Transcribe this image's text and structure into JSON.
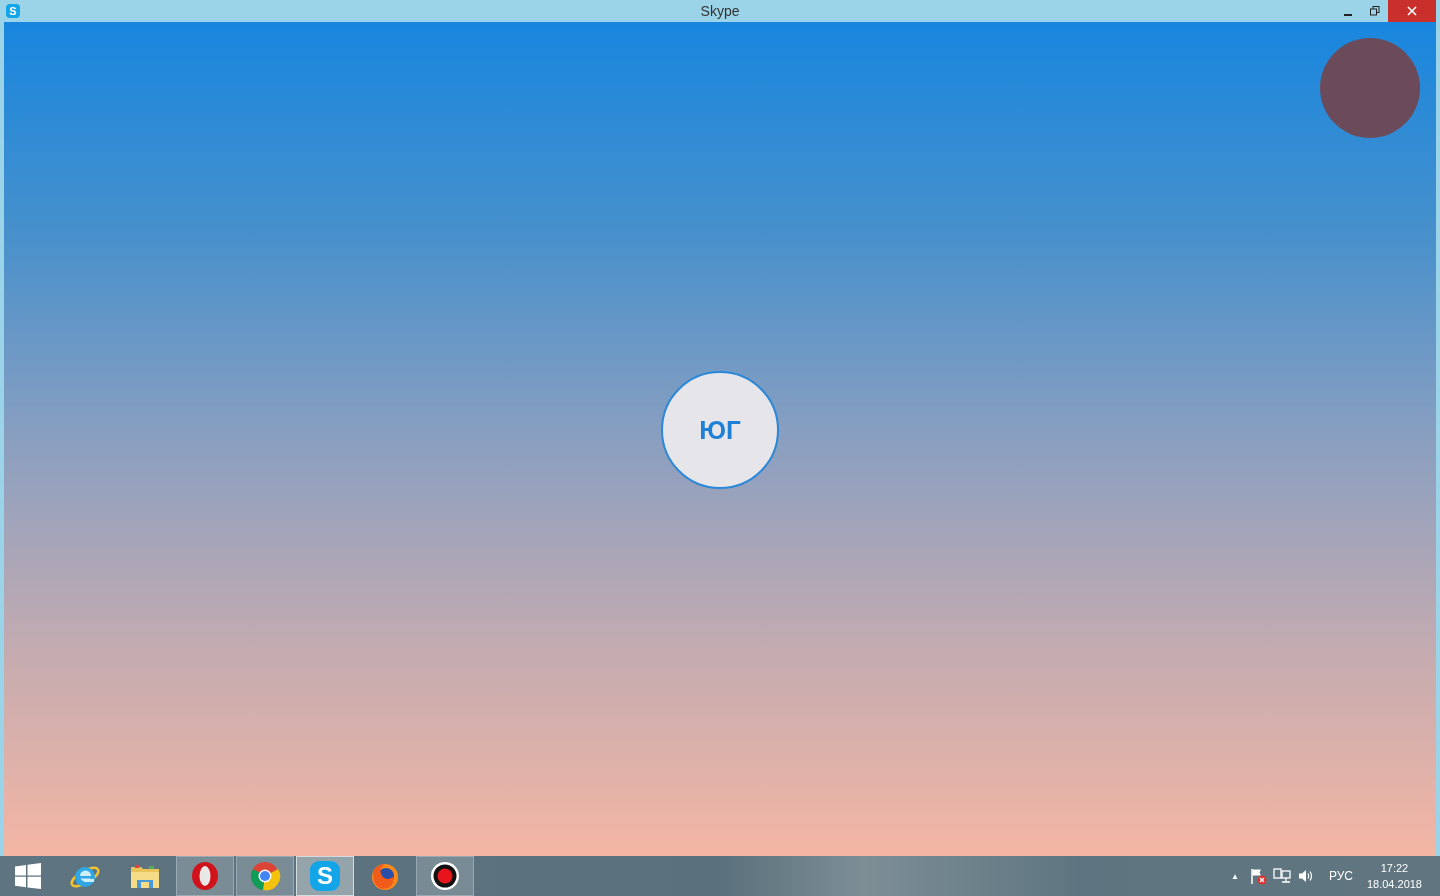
{
  "window": {
    "title": "Skype",
    "app_icon": "S"
  },
  "call": {
    "initials": "ЮГ"
  },
  "taskbar": {
    "apps": [
      {
        "kind": "ie",
        "running": false,
        "active": false
      },
      {
        "kind": "explorer",
        "running": false,
        "active": false
      },
      {
        "kind": "opera",
        "running": true,
        "active": false
      },
      {
        "kind": "chrome",
        "running": true,
        "active": false
      },
      {
        "kind": "skype",
        "running": true,
        "active": true,
        "glyph": "S"
      },
      {
        "kind": "firefox",
        "running": false,
        "active": false
      },
      {
        "kind": "recorder",
        "running": true,
        "active": false
      }
    ],
    "tray": {
      "arrow": "▲",
      "language": "РУС",
      "time": "17:22",
      "date": "18.04.2018"
    }
  }
}
